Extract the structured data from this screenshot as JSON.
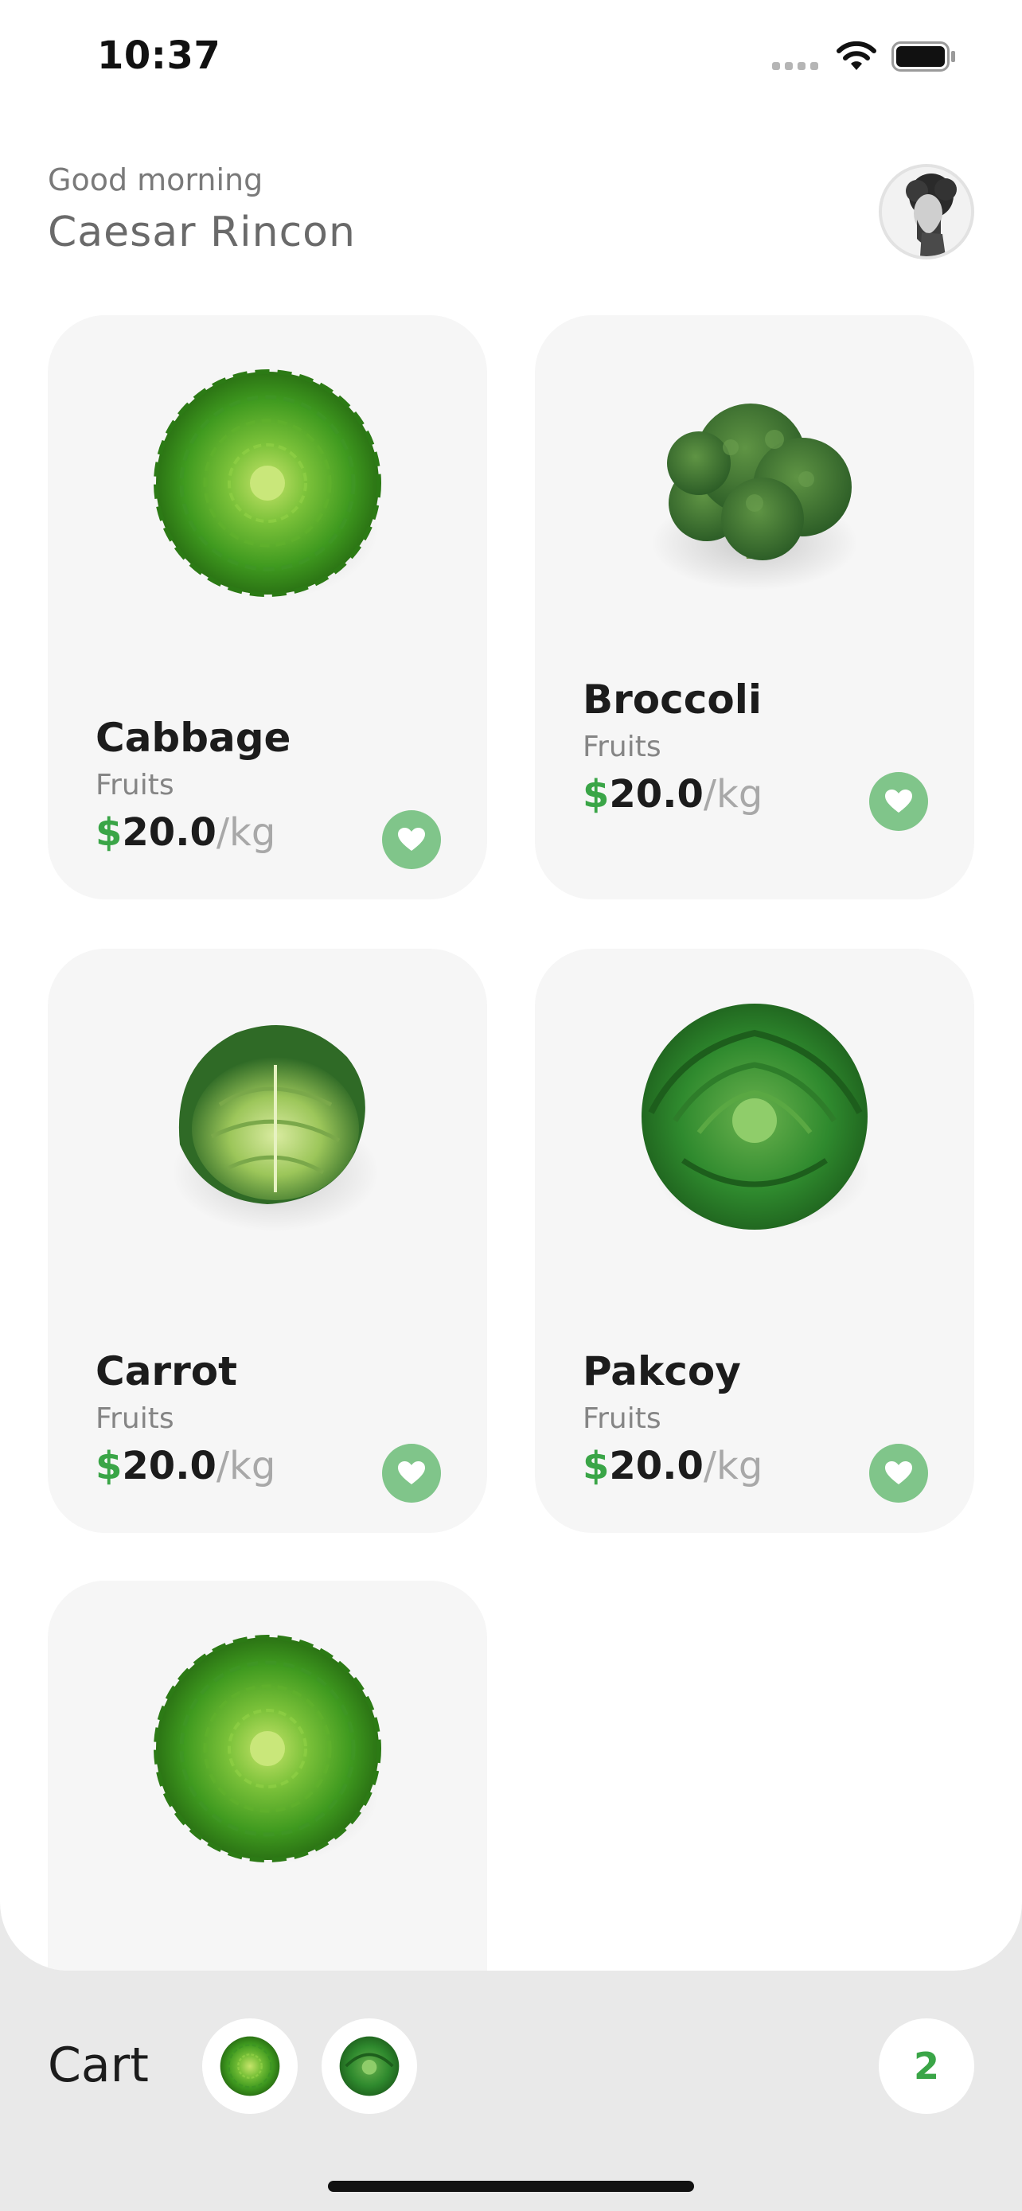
{
  "status_bar": {
    "time": "10:37",
    "icons": [
      "signal-icon",
      "wifi-icon",
      "battery-icon"
    ]
  },
  "header": {
    "greeting": "Good morning",
    "user_name": "Caesar Rincon",
    "avatar_icon": "avatar"
  },
  "products": [
    {
      "name": "Cabbage",
      "category": "Fruits",
      "currency": "$",
      "price": "20.0",
      "unit": "/kg",
      "image": "cabbage-image",
      "favorite": true
    },
    {
      "name": "Broccoli",
      "category": "Fruits",
      "currency": "$",
      "price": "20.0",
      "unit": "/kg",
      "image": "broccoli-image",
      "favorite": true
    },
    {
      "name": "Carrot",
      "category": "Fruits",
      "currency": "$",
      "price": "20.0",
      "unit": "/kg",
      "image": "savoy-cabbage-image",
      "favorite": true
    },
    {
      "name": "Pakcoy",
      "category": "Fruits",
      "currency": "$",
      "price": "20.0",
      "unit": "/kg",
      "image": "lettuce-image",
      "favorite": true
    },
    {
      "image": "cabbage-image"
    }
  ],
  "cart": {
    "label": "Cart",
    "count": "2",
    "items": [
      "cabbage-thumbnail",
      "lettuce-thumbnail"
    ]
  },
  "colors": {
    "accent": "#3aa547",
    "favorite_bg": "#80c58a",
    "card_bg": "#f6f6f6",
    "cart_bar_bg": "#e9e9e9"
  }
}
